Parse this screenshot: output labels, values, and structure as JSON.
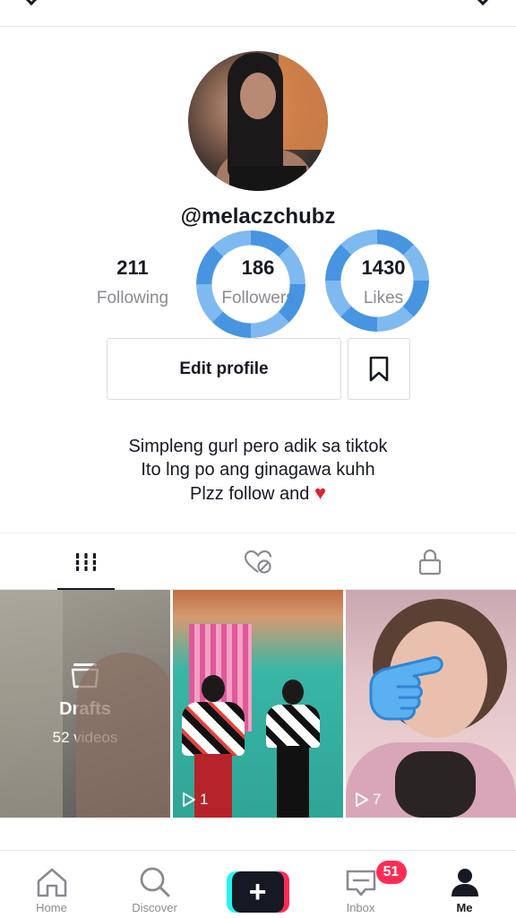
{
  "profile": {
    "username": "@melaczchubz",
    "stats": [
      {
        "value": "211",
        "label": "Following"
      },
      {
        "value": "186",
        "label": "Followers"
      },
      {
        "value": "1430",
        "label": "Likes"
      }
    ],
    "edit_profile_label": "Edit profile",
    "bio": [
      "Simpleng gurl pero adik sa tiktok",
      "Ito lng po ang ginagawa kuhh",
      "Plzz follow and"
    ],
    "bio_heart": "♥"
  },
  "tabs": {
    "videos_icon": "grid-icon",
    "liked_icon": "liked-hidden-icon",
    "private_icon": "lock-icon"
  },
  "videos": {
    "drafts_title": "Drafts",
    "drafts_count": "52 videos",
    "items": [
      {
        "plays": "1"
      },
      {
        "plays": "7"
      }
    ]
  },
  "nav": {
    "home": "Home",
    "discover": "Discover",
    "create": "+",
    "inbox": "Inbox",
    "inbox_badge": "51",
    "me": "Me"
  }
}
